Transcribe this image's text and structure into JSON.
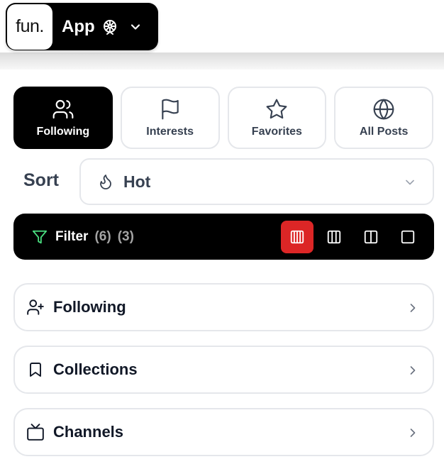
{
  "app_switcher": {
    "logo_text": "fun.",
    "label": "App",
    "icons": {
      "wheel": "ferris-wheel-icon",
      "dropdown": "chevron-down-icon"
    }
  },
  "tabs": [
    {
      "label": "Following",
      "icon": "users-icon",
      "active": true
    },
    {
      "label": "Interests",
      "icon": "flag-icon",
      "active": false
    },
    {
      "label": "Favorites",
      "icon": "star-icon",
      "active": false
    },
    {
      "label": "All Posts",
      "icon": "globe-icon",
      "active": false
    }
  ],
  "sort": {
    "label": "Sort",
    "value": "Hot",
    "icon": "flame-icon"
  },
  "filter": {
    "label": "Filter",
    "count_a": "(6)",
    "count_b": "(3)",
    "icon": "filter-icon",
    "icon_color": "#4ade80"
  },
  "layouts": [
    {
      "name": "four-columns",
      "active": true
    },
    {
      "name": "three-columns",
      "active": false
    },
    {
      "name": "two-columns",
      "active": false
    },
    {
      "name": "single-column",
      "active": false
    }
  ],
  "nav": [
    {
      "label": "Following",
      "icon": "user-plus-icon"
    },
    {
      "label": "Collections",
      "icon": "bookmark-icon"
    },
    {
      "label": "Channels",
      "icon": "tv-icon"
    }
  ],
  "colors": {
    "accent_red": "#dc2626",
    "dark": "#000000",
    "border": "#e5e7eb"
  }
}
